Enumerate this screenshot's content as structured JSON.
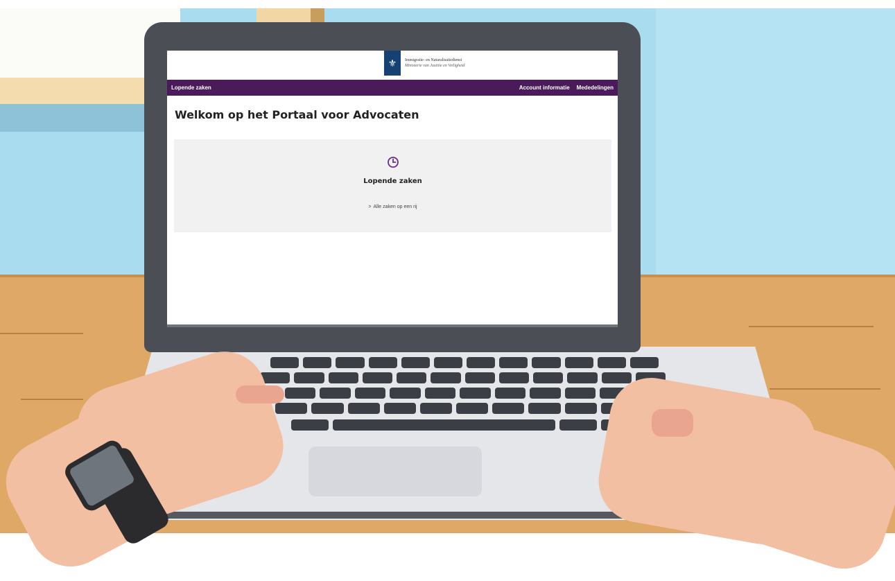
{
  "header": {
    "logo_symbol": "⚜",
    "org_name": "Immigratie- en Naturalisatiedienst",
    "ministry": "Ministerie van Justitie en Veiligheid"
  },
  "nav": {
    "left_label": "Lopende zaken",
    "account_label": "Account informatie",
    "news_label": "Mededelingen"
  },
  "main": {
    "title": "Welkom op het Portaal voor Advocaten",
    "card": {
      "icon": "clock-icon",
      "title": "Lopende zaken",
      "link_chevron": ">",
      "link_label": "Alle zaken op een rij"
    }
  },
  "colors": {
    "nav_bg": "#4a1a5a",
    "accent_purple": "#6b2d86",
    "logo_blue": "#154273",
    "card_bg": "#f1f1f1"
  }
}
